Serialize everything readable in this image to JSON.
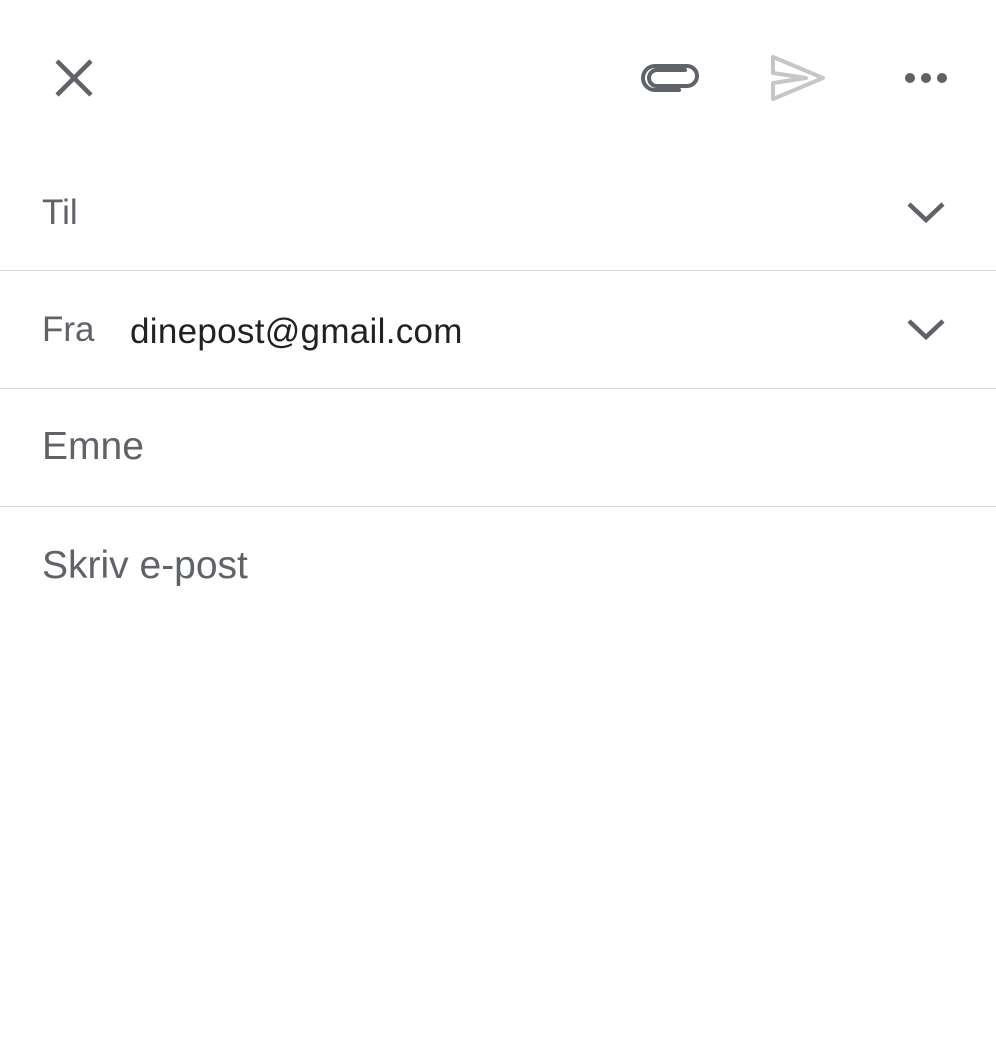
{
  "toolbar": {
    "close_icon": "close-icon",
    "attach_icon": "paperclip-icon",
    "send_icon": "send-icon",
    "more_icon": "more-horizontal-icon",
    "icon_color": "#5f6368",
    "send_disabled_color": "#c4c7c5"
  },
  "to": {
    "label": "Til",
    "expand_icon": "chevron-down-icon"
  },
  "from": {
    "label": "Fra",
    "value": "dinepost@gmail.com",
    "expand_icon": "chevron-down-icon"
  },
  "subject": {
    "placeholder": "Emne",
    "value": ""
  },
  "body": {
    "placeholder": "Skriv e-post",
    "value": ""
  }
}
